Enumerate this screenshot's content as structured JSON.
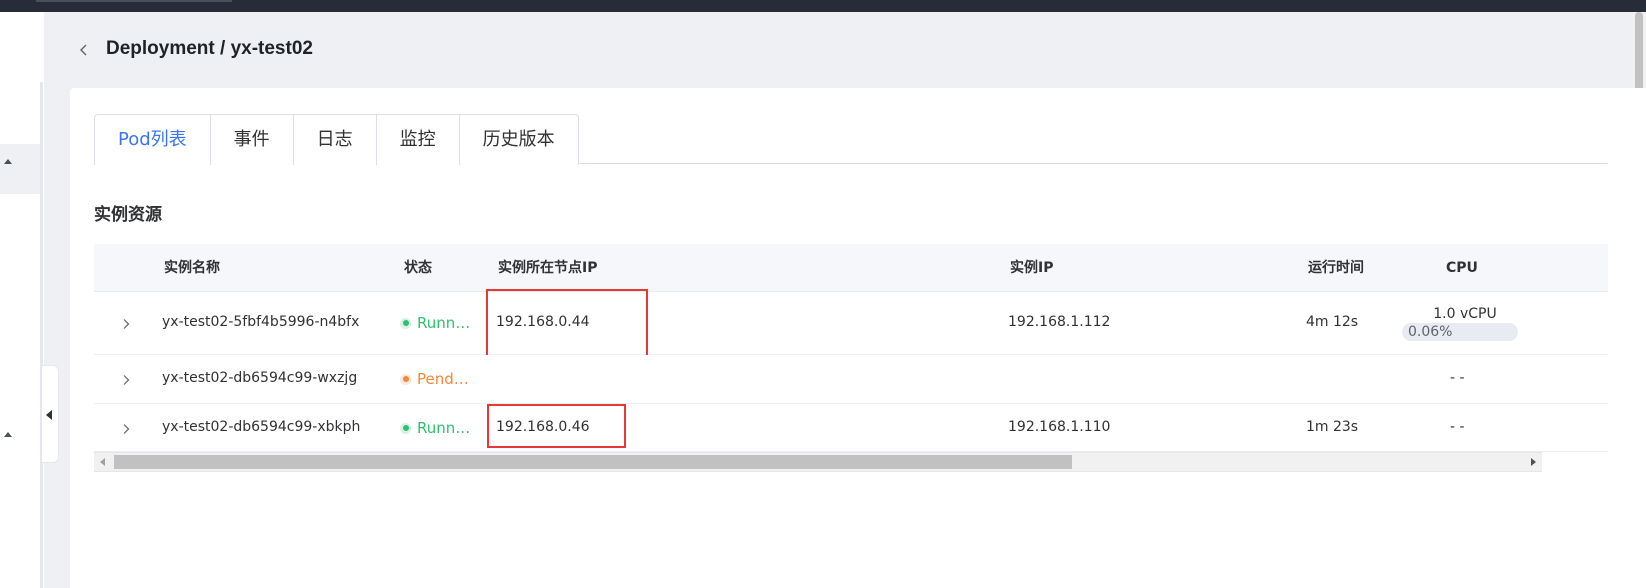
{
  "header": {
    "back_icon": "chevron-left-icon",
    "title": "Deployment / yx-test02"
  },
  "tabs": [
    {
      "label": "Pod列表",
      "active": true
    },
    {
      "label": "事件",
      "active": false
    },
    {
      "label": "日志",
      "active": false
    },
    {
      "label": "监控",
      "active": false
    },
    {
      "label": "历史版本",
      "active": false
    }
  ],
  "section": {
    "title": "实例资源"
  },
  "table": {
    "columns": {
      "name": "实例名称",
      "status": "状态",
      "node_ip": "实例所在节点IP",
      "pod_ip": "实例IP",
      "uptime": "运行时间",
      "cpu": "CPU"
    },
    "rows": [
      {
        "name": "yx-test02-5fbf4b5996-n4bfx",
        "status": "Running",
        "status_display": "Runni...",
        "status_color": "#2fbf71",
        "node_ip": "192.168.0.44",
        "pod_ip": "192.168.1.112",
        "uptime": "4m 12s",
        "cpu_value": "1.0 vCPU",
        "cpu_usage": "0.06%",
        "cpu_usage_fraction": 0.0006,
        "highlighted": true
      },
      {
        "name": "yx-test02-db6594c99-wxzjg",
        "status": "Pending",
        "status_display": "Pendi...",
        "status_color": "#f5873a",
        "node_ip": "",
        "pod_ip": "",
        "uptime": "",
        "cpu_placeholder": "- -",
        "highlighted": false
      },
      {
        "name": "yx-test02-db6594c99-xbkph",
        "status": "Running",
        "status_display": "Runni...",
        "status_color": "#2fbf71",
        "node_ip": "192.168.0.46",
        "pod_ip": "192.168.1.110",
        "uptime": "1m 23s",
        "cpu_placeholder": "- -",
        "highlighted": true
      }
    ]
  },
  "colors": {
    "accent": "#3a76f0",
    "running": "#2fbf71",
    "pending": "#f5873a",
    "highlight_box": "#e53935",
    "topbar": "#272c38"
  }
}
